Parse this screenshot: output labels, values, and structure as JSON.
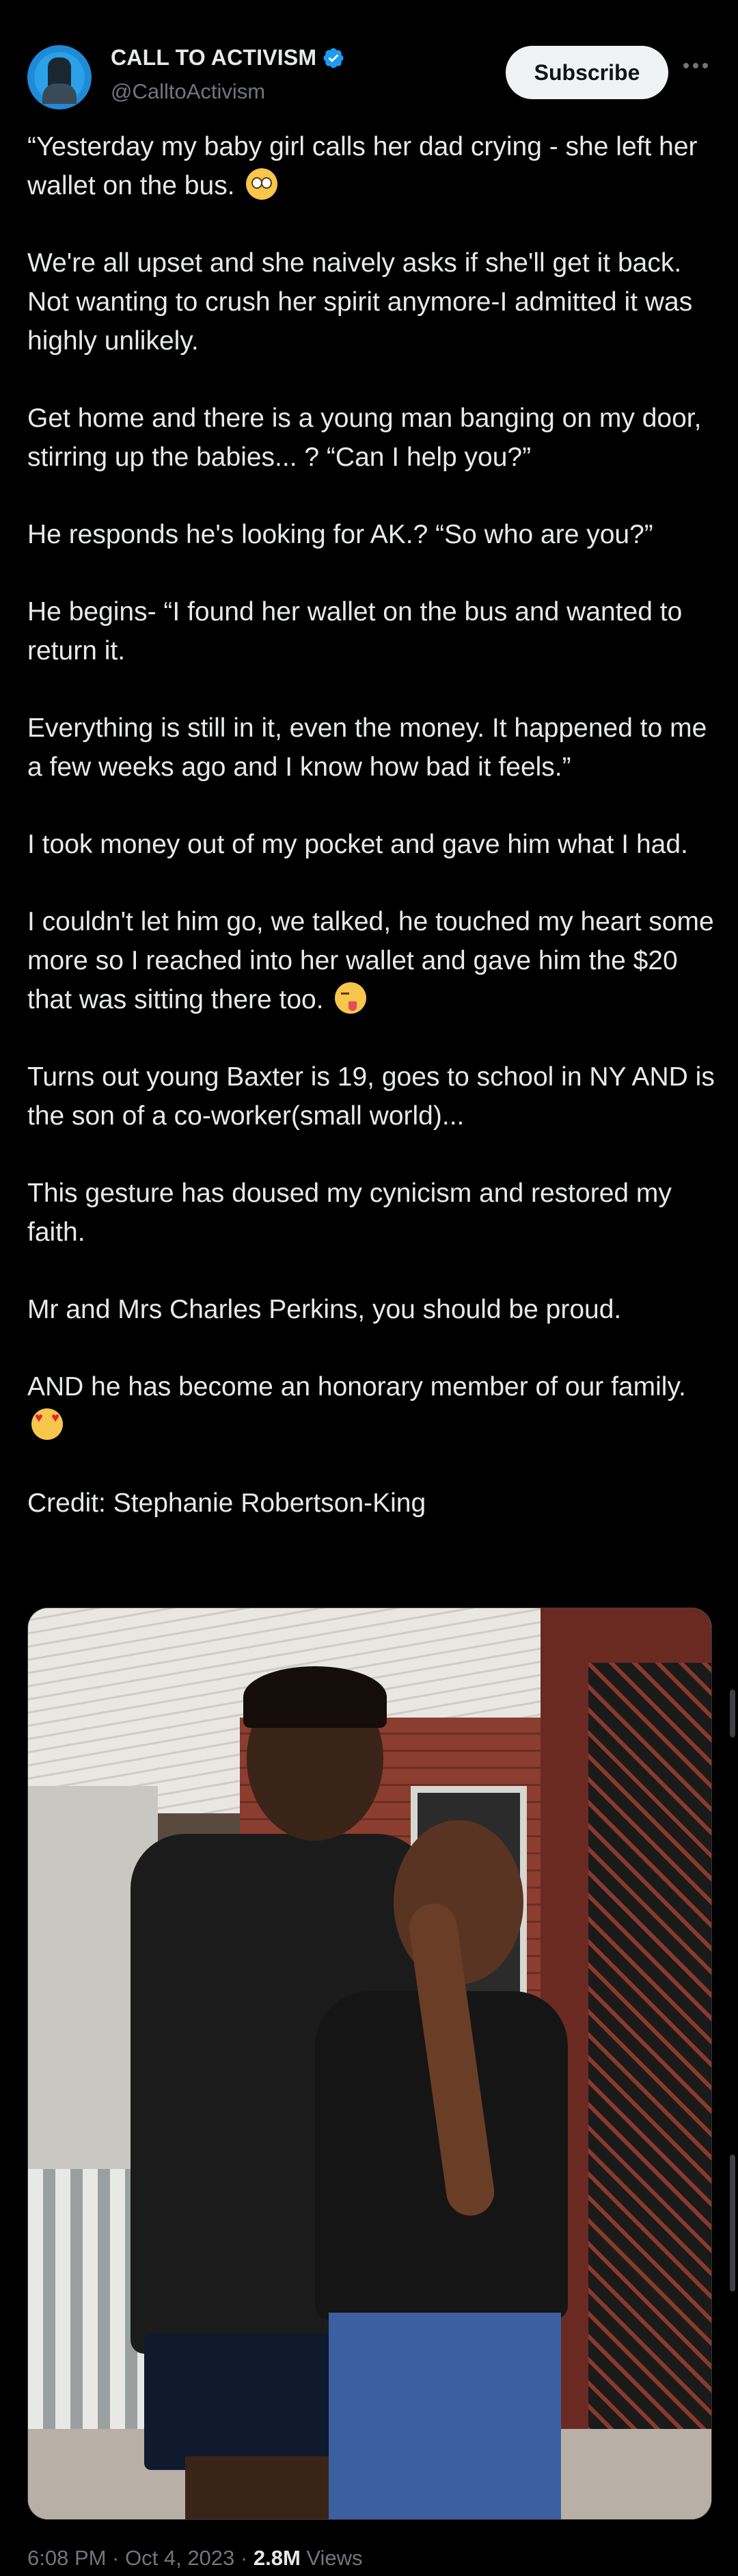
{
  "header": {
    "display_name": "CALL TO ACTIVISM",
    "handle": "@CalltoActivism",
    "subscribe_label": "Subscribe"
  },
  "tweet": {
    "paragraphs": [
      {
        "text": "“Yesterday my baby girl calls her dad crying - she left her wallet on the bus.",
        "emoji": "flushed-face"
      },
      {
        "text": "We're all upset and she naively asks if she'll get it back. Not wanting to crush her spirit anymore-I admitted it was highly unlikely."
      },
      {
        "text": "Get home and there is a young man banging on my door, stirring up the babies... ? “Can I help you?”"
      },
      {
        "text": "He responds he's looking for AK.? “So who are you?”"
      },
      {
        "text": "He begins- “I found her wallet on the bus and wanted to return it."
      },
      {
        "text": "Everything is still in it, even the money. It happened to me a few weeks ago and I know how bad it feels.”"
      },
      {
        "text": "I took money out of my pocket and gave him what I had."
      },
      {
        "text": "I couldn't let him go, we talked, he touched my heart some more so I reached into her wallet and gave him the $20 that was sitting there too.",
        "emoji": "winking-tongue-face"
      },
      {
        "text": "Turns out young Baxter is 19, goes to school in NY AND is the son of a co-worker(small world)..."
      },
      {
        "text": "This gesture has doused my cynicism and restored my faith."
      },
      {
        "text": "Mr and Mrs Charles Perkins, you should be proud."
      },
      {
        "text": "AND he has become an honorary member of our family.",
        "emoji": "heart-eyes-face"
      },
      {
        "text": "Credit: Stephanie Robertson-King"
      }
    ]
  },
  "meta": {
    "time": "6:08 PM",
    "separator": " · ",
    "date": "Oct 4, 2023",
    "views_count": "2.8M",
    "views_label": " Views"
  },
  "colors": {
    "background": "#000000",
    "text_primary": "#e7e9ea",
    "text_secondary": "#71767b",
    "verified_badge": "#1d9bf0",
    "subscribe_bg": "#eff3f4"
  }
}
